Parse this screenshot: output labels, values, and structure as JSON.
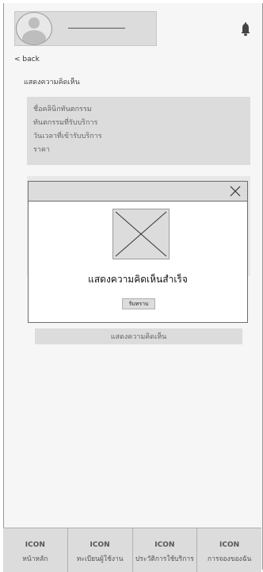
{
  "header": {
    "back_label": "< back",
    "icon_bell": "bell-icon",
    "icon_avatar": "avatar-icon"
  },
  "page": {
    "title": "แสดงความคิดเห็น"
  },
  "info_card": {
    "lines": [
      "ชื่อคลินิกทันตกรรม",
      "ทันตกรรมที่รับบริการ",
      "วันเวลาที่เข้ารับบริการ",
      "ราคา"
    ]
  },
  "actions": {
    "submit_label": "แสดงความคิดเห็น"
  },
  "modal": {
    "message": "แสดงความคิดเห็นสำเร็จ",
    "confirm_label": "รับทราบ",
    "image_icon": "image-placeholder-icon",
    "close_icon": "close-icon"
  },
  "nav": {
    "items": [
      {
        "icon": "ICON",
        "label": "หน้าหลัก"
      },
      {
        "icon": "ICON",
        "label": "ทะเบียนผู้ใช้งาน"
      },
      {
        "icon": "ICON",
        "label": "ประวัติการใช้บริการ"
      },
      {
        "icon": "ICON",
        "label": "การจองของฉัน"
      }
    ]
  }
}
